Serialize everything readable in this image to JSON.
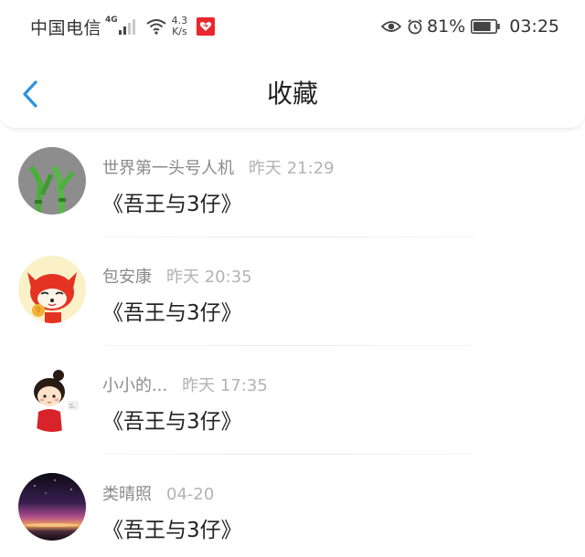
{
  "status_bar": {
    "carrier": "中国电信",
    "network": "4G",
    "speed_value": "4.3",
    "speed_unit": "K/s",
    "battery_pct": "81%",
    "time": "03:25",
    "battery_level": 0.81
  },
  "header": {
    "title": "收藏",
    "back_icon": "chevron-left-icon",
    "accent_color": "#2b93e0"
  },
  "items": [
    {
      "name": "世界第一头号人机",
      "time": "昨天 21:29",
      "content": "《吾王与3仔》"
    },
    {
      "name": "包安康",
      "time": "昨天 20:35",
      "content": "《吾王与3仔》"
    },
    {
      "name": "小小的...",
      "time": "昨天 17:35",
      "content": "《吾王与3仔》"
    },
    {
      "name": "类晴照",
      "time": "04-20",
      "content": "《吾王与3仔》"
    }
  ]
}
